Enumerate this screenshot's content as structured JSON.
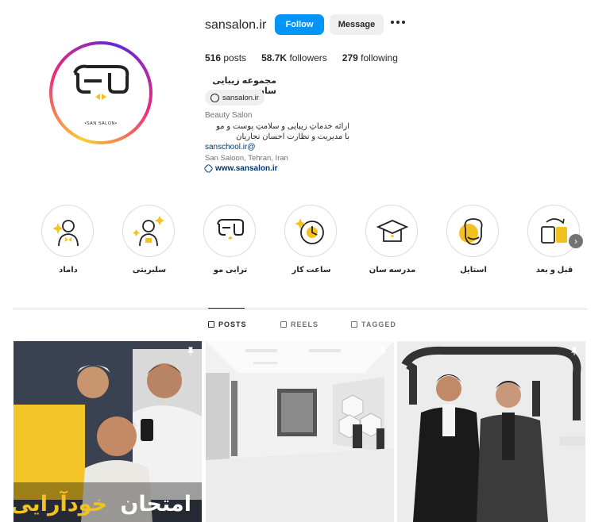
{
  "profile": {
    "username": "sansalon.ir",
    "follow_label": "Follow",
    "message_label": "Message",
    "avatar_brand": "•SAN SALON•",
    "stats": {
      "posts_count": "516",
      "posts_label": "posts",
      "followers_count": "58.7K",
      "followers_label": "followers",
      "following_count": "279",
      "following_label": "following"
    },
    "full_name": "مجموعه زیبایی سان",
    "threads_handle": "sansalon.ir",
    "category": "Beauty Salon",
    "bio_line1": "ارائه خدماتِ زیبایی و سلامتِ پوست و مو",
    "bio_line2": "با مدیریت و نظارت احسان نجاریان",
    "mention": "sanschool.ir@",
    "location": "San Saloon, Tehran, Iran",
    "website": "www.sansalon.ir"
  },
  "highlights": [
    {
      "label": "داماد",
      "icon": "groom-icon"
    },
    {
      "label": "سلبریتی",
      "icon": "celebrity-icon"
    },
    {
      "label": "ترابی مو",
      "icon": "san-logo-icon"
    },
    {
      "label": "ساعت کار",
      "icon": "clock-icon"
    },
    {
      "label": "مدرسه سان",
      "icon": "graduation-cap-icon"
    },
    {
      "label": "استایل",
      "icon": "style-face-icon"
    },
    {
      "label": "قبل و بعد",
      "icon": "before-after-icon"
    }
  ],
  "tabs": {
    "posts": "POSTS",
    "reels": "REELS",
    "tagged": "TAGGED"
  },
  "posts": [
    {
      "overlay_text_white": "امتحان",
      "overlay_text_yellow": "خودآرایی",
      "pinned": true
    },
    {
      "pinned": true
    },
    {
      "pinned": true
    }
  ],
  "colors": {
    "accent": "#0095f6",
    "brand_yellow": "#f4c21f",
    "link": "#00376b"
  }
}
